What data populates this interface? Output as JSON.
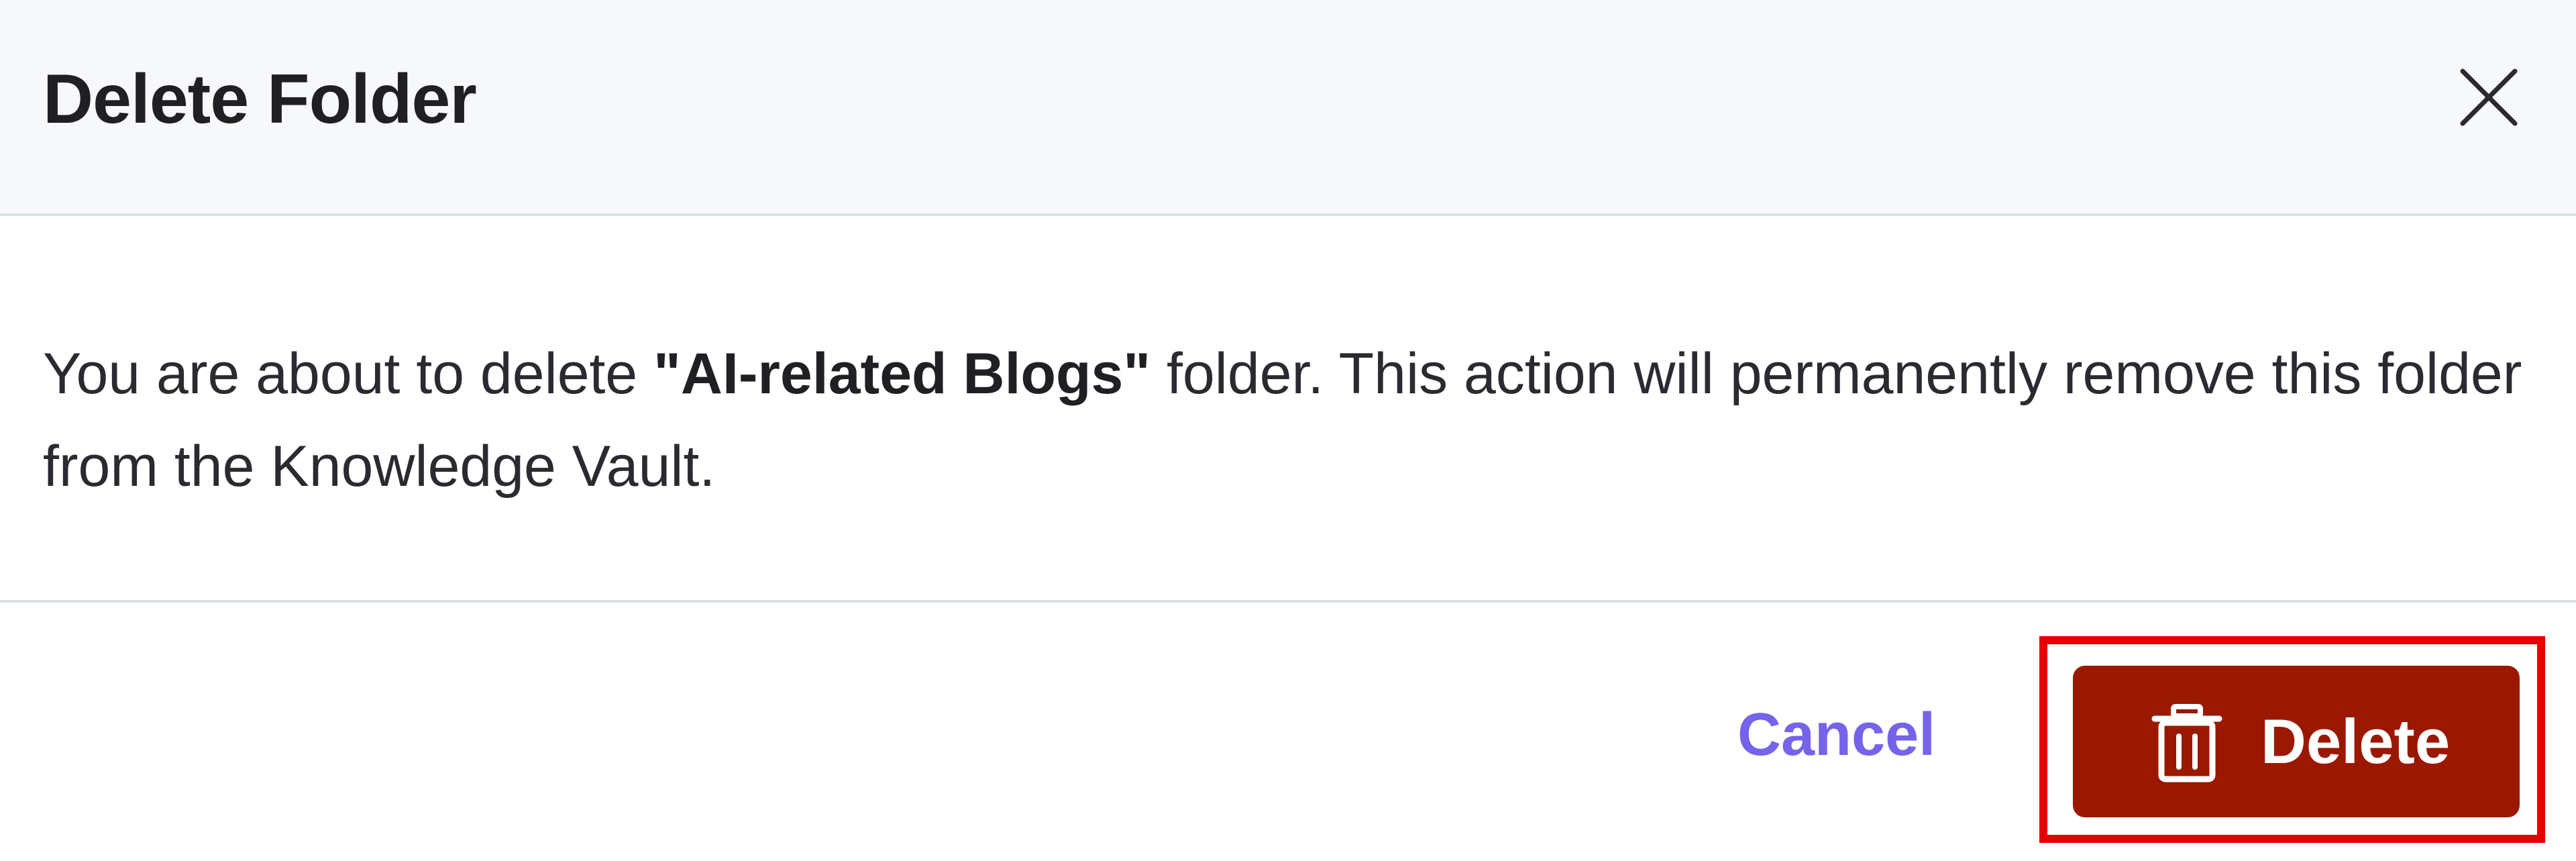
{
  "dialog": {
    "title": "Delete Folder",
    "message": {
      "prefix": "You are about to delete ",
      "folder_name": "\"AI-related Blogs\"",
      "suffix": " folder. This action will permanently remove this folder from the Knowledge Vault."
    },
    "actions": {
      "cancel_label": "Cancel",
      "delete_label": "Delete"
    },
    "icons": {
      "close": "close-icon",
      "delete": "trash-icon"
    },
    "colors": {
      "header_bg": "#f7f8fc",
      "cancel_text": "#7563ea",
      "delete_bg": "#9b1800",
      "highlight": "#e60000"
    }
  }
}
